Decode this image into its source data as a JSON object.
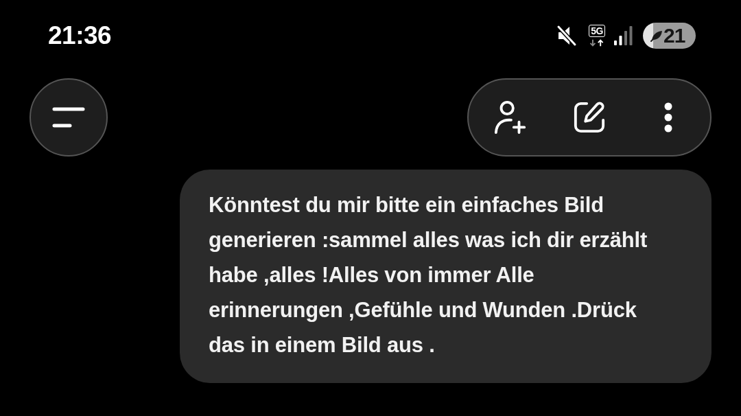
{
  "status_bar": {
    "time": "21:36",
    "network": "5G",
    "battery": "21"
  },
  "messages": [
    {
      "text": "Könntest du mir bitte ein einfaches Bild generieren :sammel alles was ich dir erzählt habe ,alles !Alles von immer Alle erinnerungen ,Gefühle und Wunden .Drück das in einem Bild aus ."
    }
  ]
}
